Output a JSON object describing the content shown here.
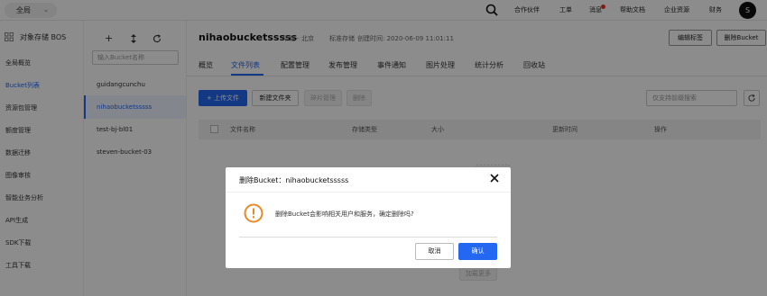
{
  "topbar": {
    "region": "全局",
    "nav": [
      "合作伙伴",
      "工单",
      "消息",
      "帮助文档",
      "企业资源",
      "财务"
    ],
    "avatar_letter": "S"
  },
  "sidebar": {
    "title": "对象存储 BOS",
    "items": [
      "全局概览",
      "Bucket列表",
      "资源包管理",
      "额度管理",
      "数据迁移",
      "图像审核",
      "智能业务分析",
      "API生成",
      "SDK下载",
      "工具下载"
    ]
  },
  "buckets": {
    "search_placeholder": "输入Bucket名称",
    "items": [
      "guidangcunchu",
      "nihaobucketsssss",
      "test-bj-bl01",
      "steven-bucket-03"
    ]
  },
  "main": {
    "bucket_name": "nihaobucketsssss",
    "region": "华北 - 北京",
    "storage_class": "标准存储",
    "created": "创建时间: 2020-06-09 11:01:11",
    "edit_tags": "编辑标签",
    "delete_bucket": "删除Bucket",
    "tabs": [
      "概览",
      "文件列表",
      "配置管理",
      "发布管理",
      "事件通知",
      "图片处理",
      "统计分析",
      "回收站"
    ],
    "toolbar": {
      "upload": "上传文件",
      "new_folder": "新建文件夹",
      "fragments": "碎片管理",
      "delete": "删除",
      "prefix_placeholder": "仅支持前缀搜索"
    },
    "columns": [
      "文件名称",
      "存储类型",
      "大小",
      "更新时间",
      "操作"
    ],
    "load_more": "加载更多"
  },
  "modal": {
    "title": "删除Bucket：nihaobucketsssss",
    "message": "删除Bucket会影响相关用户和服务，确定删除吗?",
    "cancel": "取消",
    "confirm": "确认"
  },
  "colors": {
    "accent": "#2468f2",
    "warning": "#e8892a",
    "notification_dot": "#e5362c"
  }
}
